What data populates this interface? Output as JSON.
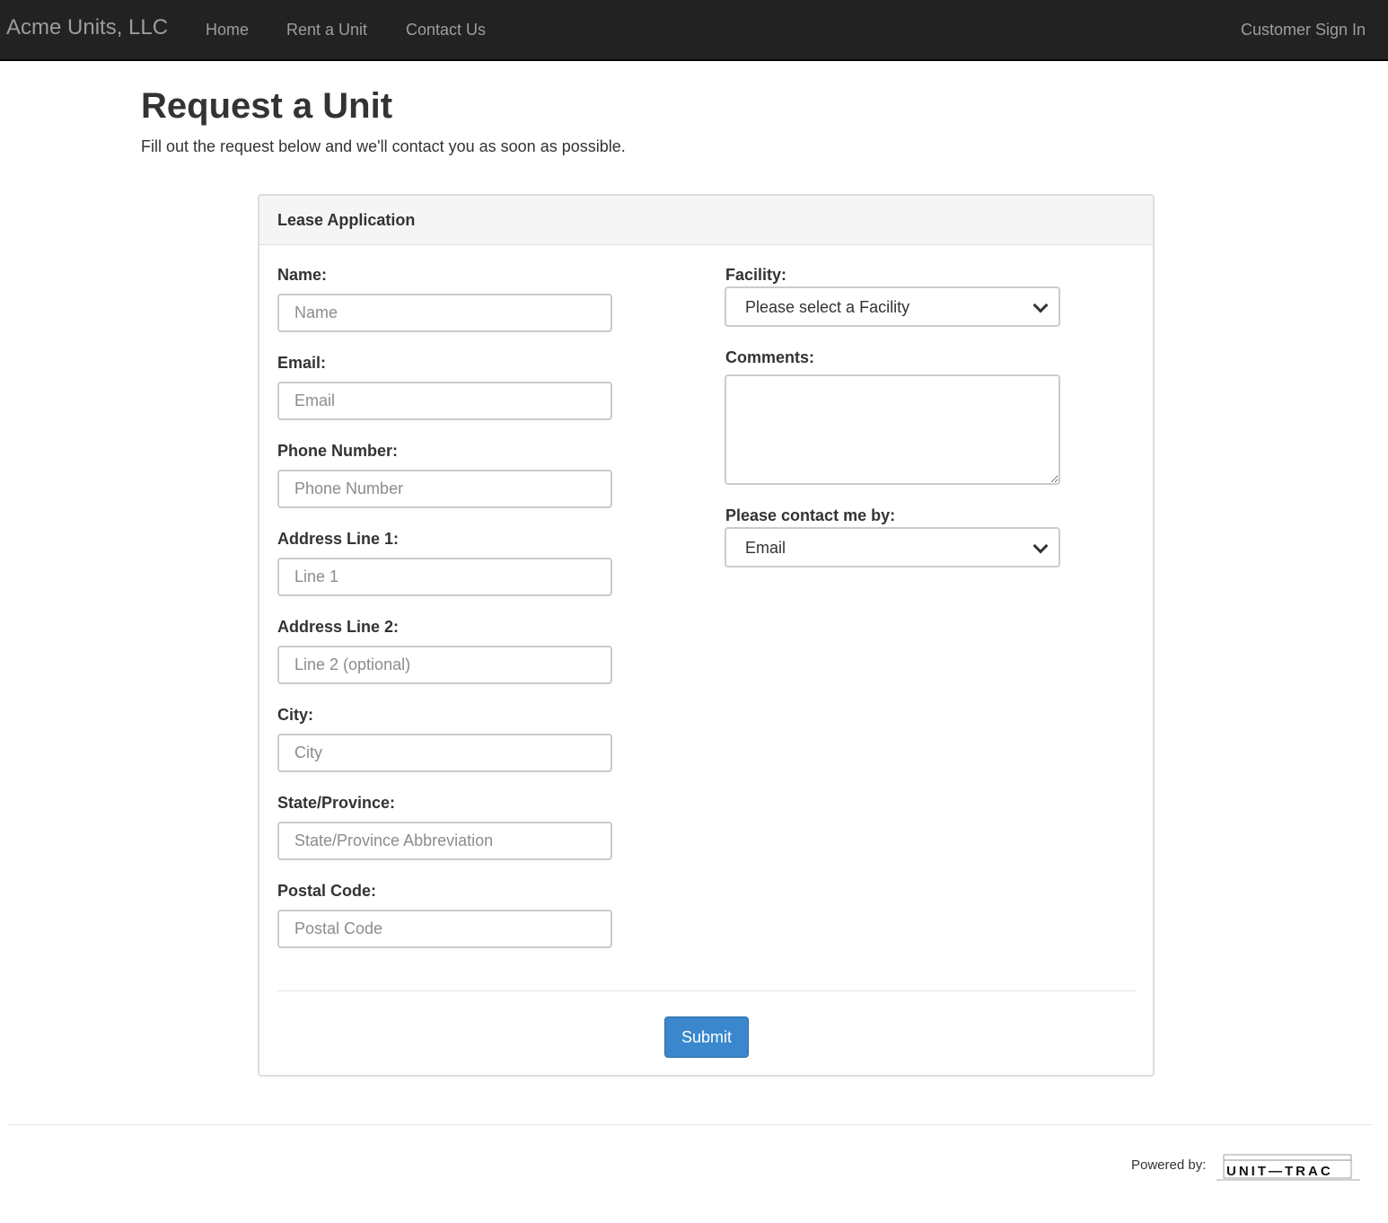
{
  "navbar": {
    "brand": "Acme Units, LLC",
    "links": [
      "Home",
      "Rent a Unit",
      "Contact Us"
    ],
    "signin": "Customer Sign In"
  },
  "page": {
    "title": "Request a Unit",
    "subtitle": "Fill out the request below and we'll contact you as soon as possible."
  },
  "panel": {
    "title": "Lease Application",
    "fields": [
      {
        "label": "Name:",
        "placeholder": "Name"
      },
      {
        "label": "Email:",
        "placeholder": "Email"
      },
      {
        "label": "Phone Number:",
        "placeholder": "Phone Number"
      },
      {
        "label": "Address Line 1:",
        "placeholder": "Line 1"
      },
      {
        "label": "Address Line 2:",
        "placeholder": "Line 2 (optional)"
      },
      {
        "label": "City:",
        "placeholder": "City"
      },
      {
        "label": "State/Province:",
        "placeholder": "State/Province Abbreviation"
      },
      {
        "label": "Postal Code:",
        "placeholder": "Postal Code"
      }
    ],
    "facility": {
      "label": "Facility:",
      "value": "Please select a Facility"
    },
    "comments": {
      "label": "Comments:",
      "value": ""
    },
    "contact": {
      "label": "Please contact me by:",
      "value": "Email"
    },
    "submit": "Submit"
  },
  "footer": {
    "powered_by": "Powered by:",
    "logo_text": "UNIT TRAC"
  },
  "colors": {
    "navbar": "#222222",
    "primary": "#3a87cd"
  }
}
